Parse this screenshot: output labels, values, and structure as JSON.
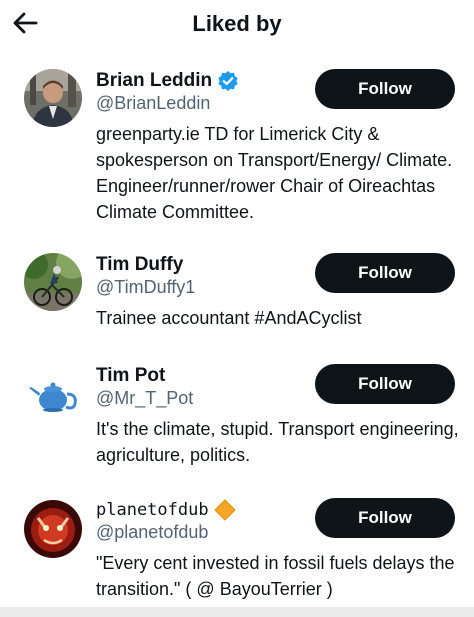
{
  "header": {
    "title": "Liked by"
  },
  "users": [
    {
      "name": "Brian Leddin",
      "handle": "@BrianLeddin",
      "bio": "greenparty.ie TD for Limerick City & spokesperson on Transport/Energy/ Climate. Engineer/runner/rower Chair of Oireachtas Climate Committee.",
      "follow_label": "Follow",
      "badge": "verified-badge"
    },
    {
      "name": "Tim Duffy",
      "handle": "@TimDuffy1",
      "bio": "Trainee accountant #AndACyclist",
      "follow_label": "Follow"
    },
    {
      "name": "Tim Pot",
      "handle": "@Mr_T_Pot",
      "bio": "It's the climate, stupid. Transport engineering, agriculture, politics.",
      "follow_label": "Follow"
    },
    {
      "name": "planetofdub",
      "handle": "@planetofdub",
      "bio": "\"Every cent invested in fossil fuels delays the transition.\" ( @ BayouTerrier )",
      "follow_label": "Follow",
      "badge": "orange-diamond-emoji"
    }
  ],
  "colors": {
    "button": "#0f1419",
    "verified": "#1d9bf0",
    "secondary": "#536471"
  }
}
